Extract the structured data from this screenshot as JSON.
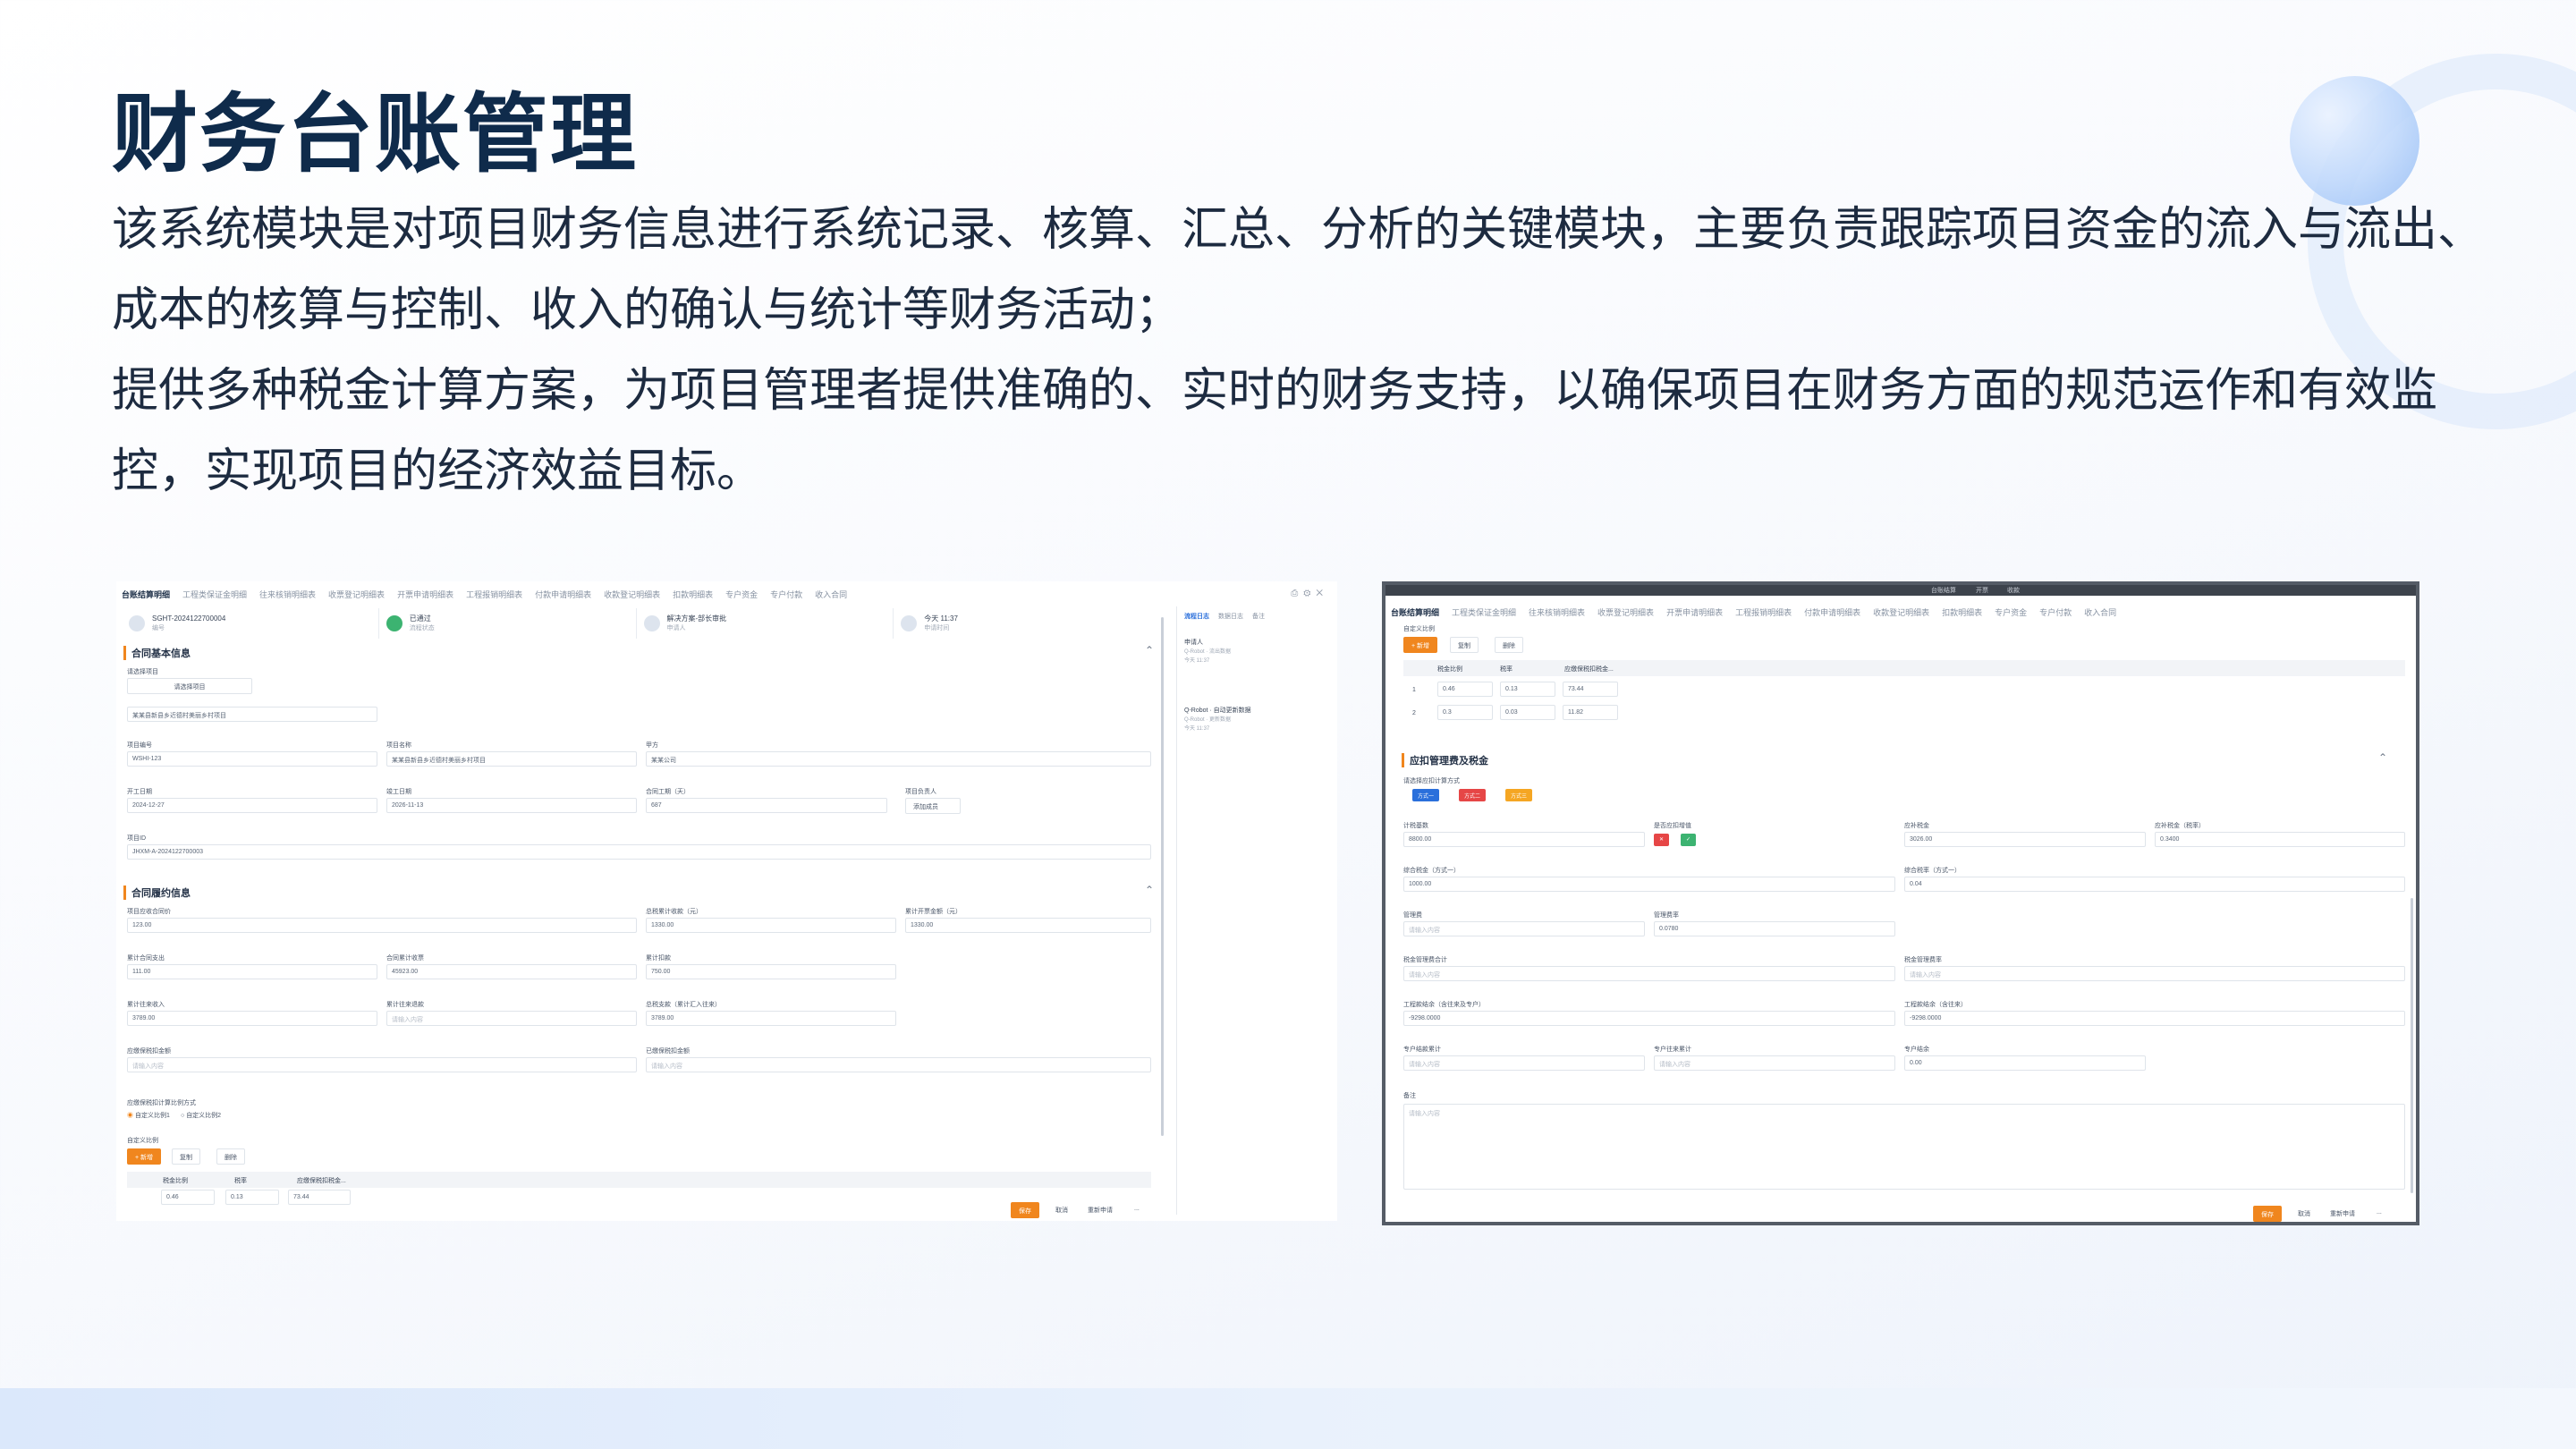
{
  "page": {
    "title": "财务台账管理",
    "description": [
      "该系统模块是对项目财务信息进行系统记录、核算、汇总、分析的关键模块，主要负责跟踪项目资金的流入与流出、成本的核算与控制、收入的确认与统计等财务活动；",
      "提供多种税金计算方案，为项目管理者提供准确的、实时的财务支持，以确保项目在财务方面的规范运作和有效监控，实现项目的经济效益目标。"
    ]
  },
  "left_shot": {
    "tabs": [
      "台账结算明细",
      "工程类保证金明细",
      "往来核销明细表",
      "收票登记明细表",
      "开票申请明细表",
      "工程报销明细表",
      "付款申请明细表",
      "收款登记明细表",
      "扣款明细表",
      "专户资金",
      "专户付款",
      "收入合同"
    ],
    "status": [
      {
        "title": "SGHT-2024122700004",
        "sub": "编号"
      },
      {
        "title": "已通过",
        "sub": "流程状态"
      },
      {
        "title": "解决方案-部长审批",
        "sub": "申请人"
      },
      {
        "title": "今天 11:37",
        "sub": "申请时间"
      }
    ],
    "section_basic": "合同基本信息",
    "select_project_label": "请选择项目",
    "select_project_btn": "请选择项目",
    "project_desc_value": "某某县新县乡近德村美丽乡村项目",
    "fields": {
      "project_no_label": "项目编号",
      "project_no": "WSHI-123",
      "project_name_label": "项目名称",
      "project_name": "某某县新县乡近德村美丽乡村项目",
      "party_a_label": "甲方",
      "party_a": "某某公司",
      "start_date_label": "开工日期",
      "start_date": "2024-12-27",
      "end_date_label": "竣工日期",
      "end_date": "2026-11-13",
      "period_label": "合同工期（天）",
      "period": "687",
      "owner_label": "项目负责人",
      "owner_btn": "添加成员",
      "project_id_label": "项目ID",
      "project_id": "JHXM-A-2024122700003"
    },
    "section_perf": "合同履约信息",
    "perf": {
      "contract_amount_label": "项目应收合同价",
      "contract_amount": "123.00",
      "invoice_label": "总税累计收款（元）",
      "invoice": "1330.00",
      "cumulative_label": "累计开票金额（元）",
      "cumulative": "1330.00",
      "payout_label": "累计合同支出",
      "payout": "111.00",
      "tax_label": "合同累计收票",
      "tax": "45923.00",
      "deduct_label": "累计扣款",
      "deduct": "750.00",
      "income_label": "累计往来收入",
      "income": "3789.00",
      "back_label": "累计往来退款",
      "back_ph": "请输入内容",
      "total_label": "总税支款（累计汇入往来）",
      "total": "3789.00",
      "deposit_label": "应缴保税扣金额",
      "deposit_ph": "请输入内容",
      "paid_label": "已缴保税扣金额",
      "paid_ph": "请输入内容"
    },
    "method_label": "应缴保税扣计算比例方式",
    "method_opt1": "自定义比例1",
    "method_opt2": "自定义比例2",
    "ratio_label": "自定义比例",
    "actions": {
      "add": "+ 新增",
      "copy": "复制",
      "delete": "删除"
    },
    "table_head": [
      "税金比例",
      "税率",
      "应缴保税扣税金..."
    ],
    "table_row": {
      "ratio": "0.46",
      "rate": "0.13",
      "amount": "73.44"
    },
    "footer": {
      "submit": "保存",
      "cancel": "取消",
      "back": "重新申请",
      "more": "..."
    },
    "side_tabs": [
      "流程日志",
      "数据日志",
      "备注"
    ],
    "timeline": [
      {
        "title": "申请人",
        "name": "Q-Robot · 流出数据",
        "time": "今天 11:37"
      },
      {
        "title": "Q-Robot · 自动更新数据",
        "name": "Q-Robot · 更新数据",
        "time": "今天 11:37"
      }
    ]
  },
  "right_shot": {
    "top_tabs": [
      "台账结算",
      "开票",
      "收款"
    ],
    "tabs": [
      "台账结算明细",
      "工程类保证金明细",
      "往来核销明细表",
      "收票登记明细表",
      "开票申请明细表",
      "工程报销明细表",
      "付款申请明细表",
      "收款登记明细表",
      "扣款明细表",
      "专户资金",
      "专户付款",
      "收入合同"
    ],
    "ratio_label": "自定义比例",
    "actions": {
      "add": "+ 新增",
      "copy": "复制",
      "delete": "删除"
    },
    "table_head": [
      "税金比例",
      "税率",
      "应缴保税扣税金..."
    ],
    "rows": [
      {
        "no": "1",
        "ratio": "0.46",
        "rate": "0.13",
        "amount": "73.44"
      },
      {
        "no": "2",
        "ratio": "0.3",
        "rate": "0.03",
        "amount": "11.82"
      }
    ],
    "section": "应扣管理费及税金",
    "method_label": "请选择应扣计算方式",
    "tags": [
      {
        "label": "方式一",
        "color": "#2a6fdb"
      },
      {
        "label": "方式二",
        "color": "#e64646"
      },
      {
        "label": "方式三",
        "color": "#f5a623"
      }
    ],
    "fields": [
      {
        "label": "计税基数",
        "value": "8800.00"
      },
      {
        "label": "是否应扣增值",
        "value": ""
      },
      {
        "label": "应补税金",
        "value": "3026.00"
      },
      {
        "label": "应补税金（税率）",
        "value": "0.3400"
      },
      {
        "label": "综合税金（方式一）",
        "value": "1000.00"
      },
      {
        "label": "综合税率（方式一）",
        "value": "0.04"
      },
      {
        "label": "管理费",
        "value": "请输入内容"
      },
      {
        "label": "管理费率",
        "value": "0.0780"
      },
      {
        "label": "税金管理费合计",
        "value": "请输入内容"
      },
      {
        "label": "税金管理费率",
        "value": "请输入内容"
      },
      {
        "label": "工程款结余（含往来及专户）",
        "value": "-9298.0000"
      },
      {
        "label": "工程款结余（含往来）",
        "value": "-9298.0000"
      },
      {
        "label": "专户结款累计",
        "value": "请输入内容"
      },
      {
        "label": "专户往来累计",
        "value": "请输入内容"
      },
      {
        "label": "专户结余",
        "value": "0.00"
      }
    ],
    "remark_label": "备注",
    "remark_ph": "请输入内容",
    "footer": {
      "submit": "保存",
      "cancel": "取消",
      "back": "重新申请",
      "more": "..."
    }
  }
}
